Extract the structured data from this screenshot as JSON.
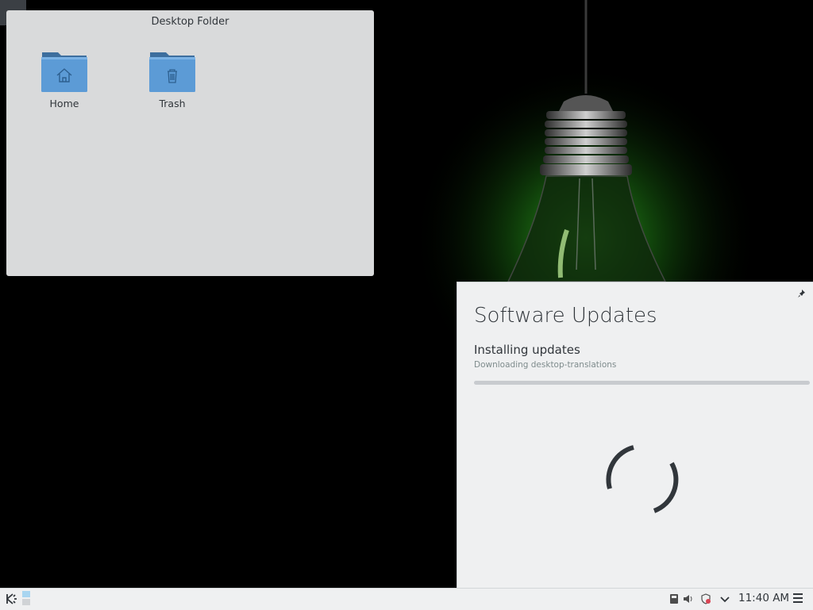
{
  "desktop_folder": {
    "title": "Desktop Folder",
    "items": [
      {
        "label": "Home",
        "icon": "home-folder-icon"
      },
      {
        "label": "Trash",
        "icon": "trash-folder-icon"
      }
    ]
  },
  "software_updates": {
    "title": "Software Updates",
    "status": "Installing updates",
    "detail": "Downloading desktop-translations",
    "progress": 0,
    "pin_icon": "pin-icon"
  },
  "taskbar": {
    "launcher_icon": "kde-launcher-icon",
    "tray_icons": [
      "storage-icon",
      "volume-icon",
      "update-notifier-icon",
      "expand-tray-icon"
    ],
    "clock": "11:40 AM",
    "menu_icon": "panel-menu-icon"
  },
  "colors": {
    "accent": "#3daee9",
    "folder_blue": "#5c9bd6",
    "panel_bg": "#eff0f1",
    "wallpaper_glow": "#1f7a16"
  }
}
